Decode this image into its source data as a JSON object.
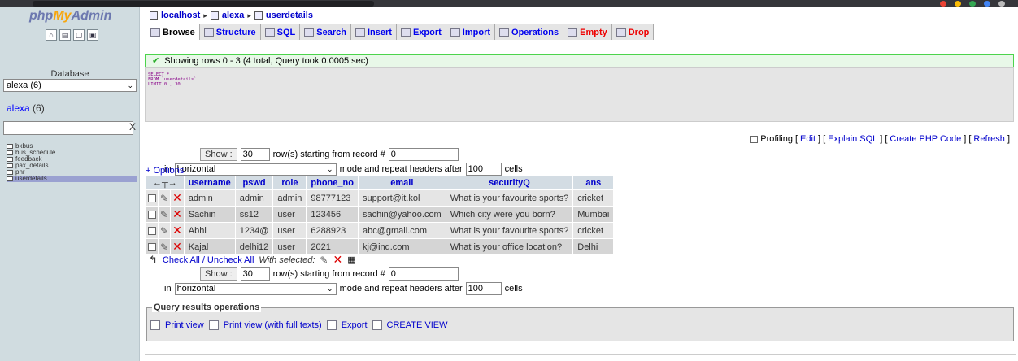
{
  "colors": {
    "accent_link": "#0000cc",
    "success_border": "#4cd44c",
    "sidebar_bg": "#d0dce0"
  },
  "sidebar": {
    "logo": {
      "php": "php",
      "my": "My",
      "admin": "Admin"
    },
    "icons": [
      "home-icon",
      "sql-query-icon",
      "query-window-icon",
      "docs-icon"
    ],
    "database_label": "Database",
    "database_select": "alexa (6)",
    "current_db": "alexa",
    "current_db_count": "(6)",
    "filter_clear": "X",
    "tables": [
      "bkbus",
      "bus_schedule",
      "feedback",
      "pax_details",
      "pnr",
      "userdetails"
    ]
  },
  "breadcrumb": {
    "server": "localhost",
    "database": "alexa",
    "table": "userdetails"
  },
  "tabs": [
    {
      "label": "Browse",
      "icon": "browse-icon"
    },
    {
      "label": "Structure",
      "icon": "structure-icon"
    },
    {
      "label": "SQL",
      "icon": "sql-icon"
    },
    {
      "label": "Search",
      "icon": "search-icon"
    },
    {
      "label": "Insert",
      "icon": "insert-icon"
    },
    {
      "label": "Export",
      "icon": "export-icon"
    },
    {
      "label": "Import",
      "icon": "import-icon"
    },
    {
      "label": "Operations",
      "icon": "operations-icon"
    },
    {
      "label": "Empty",
      "icon": "empty-icon"
    },
    {
      "label": "Drop",
      "icon": "drop-icon"
    }
  ],
  "status": {
    "message": "Showing rows 0 - 3 (4 total, Query took 0.0005 sec)"
  },
  "sql": {
    "line1": "SELECT *",
    "line2": "FROM `userdetails`",
    "line3": "LIMIT 0 , 30"
  },
  "profiling": {
    "label": "Profiling",
    "edit": "Edit",
    "explain": "Explain SQL",
    "php": "Create PHP Code",
    "refresh": "Refresh"
  },
  "navigation": {
    "show_label": "Show :",
    "rows": "30",
    "starting_text": "row(s) starting from record #",
    "start_record": "0",
    "in_text": "in",
    "mode": "horizontal",
    "mode_text": "mode and repeat headers after",
    "repeat": "100",
    "cells_text": "cells"
  },
  "options_link": "+ Options",
  "results": {
    "columns": [
      "username",
      "pswd",
      "role",
      "phone_no",
      "email",
      "securityQ",
      "ans"
    ],
    "rows": [
      [
        "admin",
        "admin",
        "admin",
        "98777123",
        "support@it.kol",
        "What is your favourite sports?",
        "cricket"
      ],
      [
        "Sachin",
        "ss12",
        "user",
        "123456",
        "sachin@yahoo.com",
        "Which city were you born?",
        "Mumbai"
      ],
      [
        "Abhi",
        "1234@",
        "user",
        "6288923",
        "abc@gmail.com",
        "What is your favourite sports?",
        "cricket"
      ],
      [
        "Kajal",
        "delhi12",
        "user",
        "2021",
        "kj@ind.com",
        "What is your office location?",
        "Delhi"
      ]
    ]
  },
  "bulk": {
    "check_all": "Check All / Uncheck All",
    "with_selected": "With selected:"
  },
  "query_ops": {
    "legend": "Query results operations",
    "print": "Print view",
    "print_full": "Print view (with full texts)",
    "export": "Export",
    "create_view": "CREATE VIEW"
  }
}
